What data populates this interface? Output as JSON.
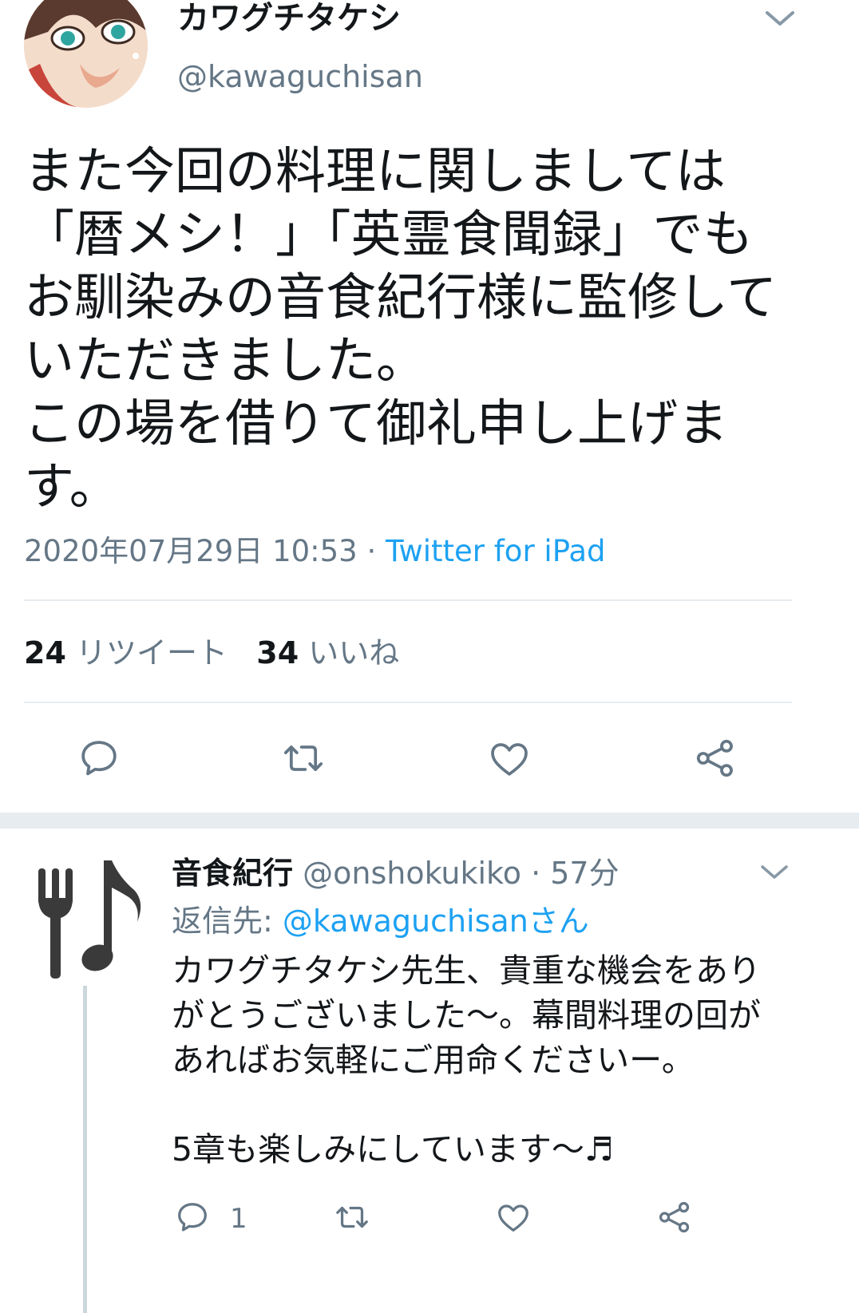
{
  "main_tweet": {
    "display_name": "カワグチタケシ",
    "handle": "@kawaguchisan",
    "text": "また今回の料理に関しましては\n「暦メシ！」「英霊食聞録」でも\nお馴染みの音食紀行様に監修して\nいただきました。\nこの場を借りて御礼申し上げま\nす。",
    "timestamp": "2020年07月29日 10:53",
    "separator": " · ",
    "client": "Twitter for iPad",
    "retweet_count": "24",
    "retweet_label": "リツイート",
    "like_count": "34",
    "like_label": "いいね"
  },
  "reply_tweet": {
    "display_name": "音食紀行",
    "handle": "@onshokukiko",
    "time": "· 57分",
    "reply_prefix": "返信先: ",
    "reply_mention": "@kawaguchisanさん",
    "text": "カワグチタケシ先生、貴重な機会をあり\nがとうございました〜。幕間料理の回が\nあればお気軽にご用命くださいー。\n\n5章も楽しみにしています〜♬",
    "reply_count": "1"
  },
  "icons": [
    "chevron-down-icon",
    "reply-icon",
    "retweet-icon",
    "like-icon",
    "share-icon"
  ],
  "colors": {
    "text": "#14171a",
    "secondary": "#657786",
    "accent": "#1da1f2",
    "divider": "#e6ecf0",
    "icon": "#657786"
  }
}
